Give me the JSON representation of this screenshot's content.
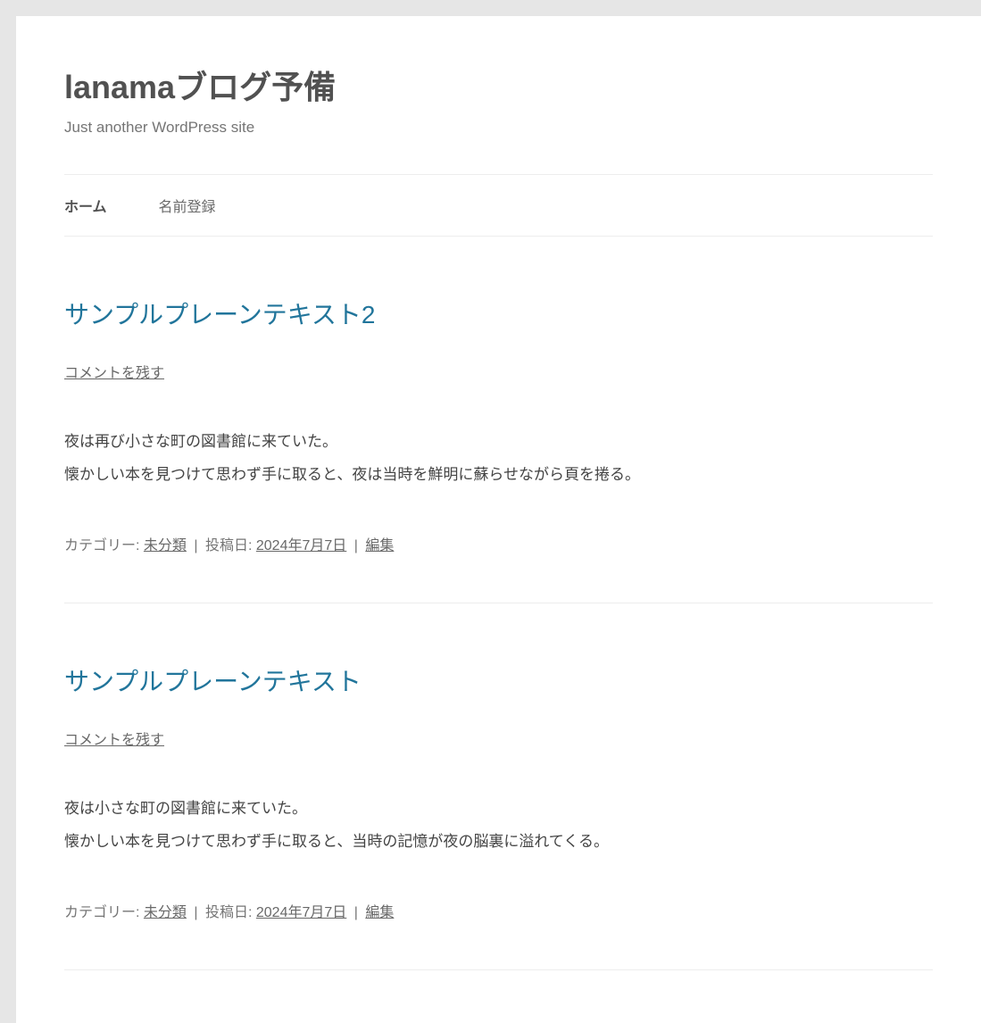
{
  "header": {
    "site_title": "lanamaブログ予備",
    "tagline": "Just another WordPress site"
  },
  "nav": {
    "items": [
      {
        "label": "ホーム",
        "active": true
      },
      {
        "label": "名前登録",
        "active": false
      }
    ]
  },
  "posts": [
    {
      "title": "サンプルプレーンテキスト2",
      "comment_link": "コメントを残す",
      "body_line1": "夜は再び小さな町の図書館に来ていた。",
      "body_line2": "懐かしい本を見つけて思わず手に取ると、夜は当時を鮮明に蘇らせながら頁を捲る。",
      "meta": {
        "category_label": "カテゴリー: ",
        "category": "未分類",
        "date_label": "投稿日: ",
        "date": "2024年7月7日",
        "edit": "編集",
        "sep": " | "
      }
    },
    {
      "title": "サンプルプレーンテキスト",
      "comment_link": "コメントを残す",
      "body_line1": "夜は小さな町の図書館に来ていた。",
      "body_line2": "懐かしい本を見つけて思わず手に取ると、当時の記憶が夜の脳裏に溢れてくる。",
      "meta": {
        "category_label": "カテゴリー: ",
        "category": "未分類",
        "date_label": "投稿日: ",
        "date": "2024年7月7日",
        "edit": "編集",
        "sep": " | "
      }
    }
  ]
}
